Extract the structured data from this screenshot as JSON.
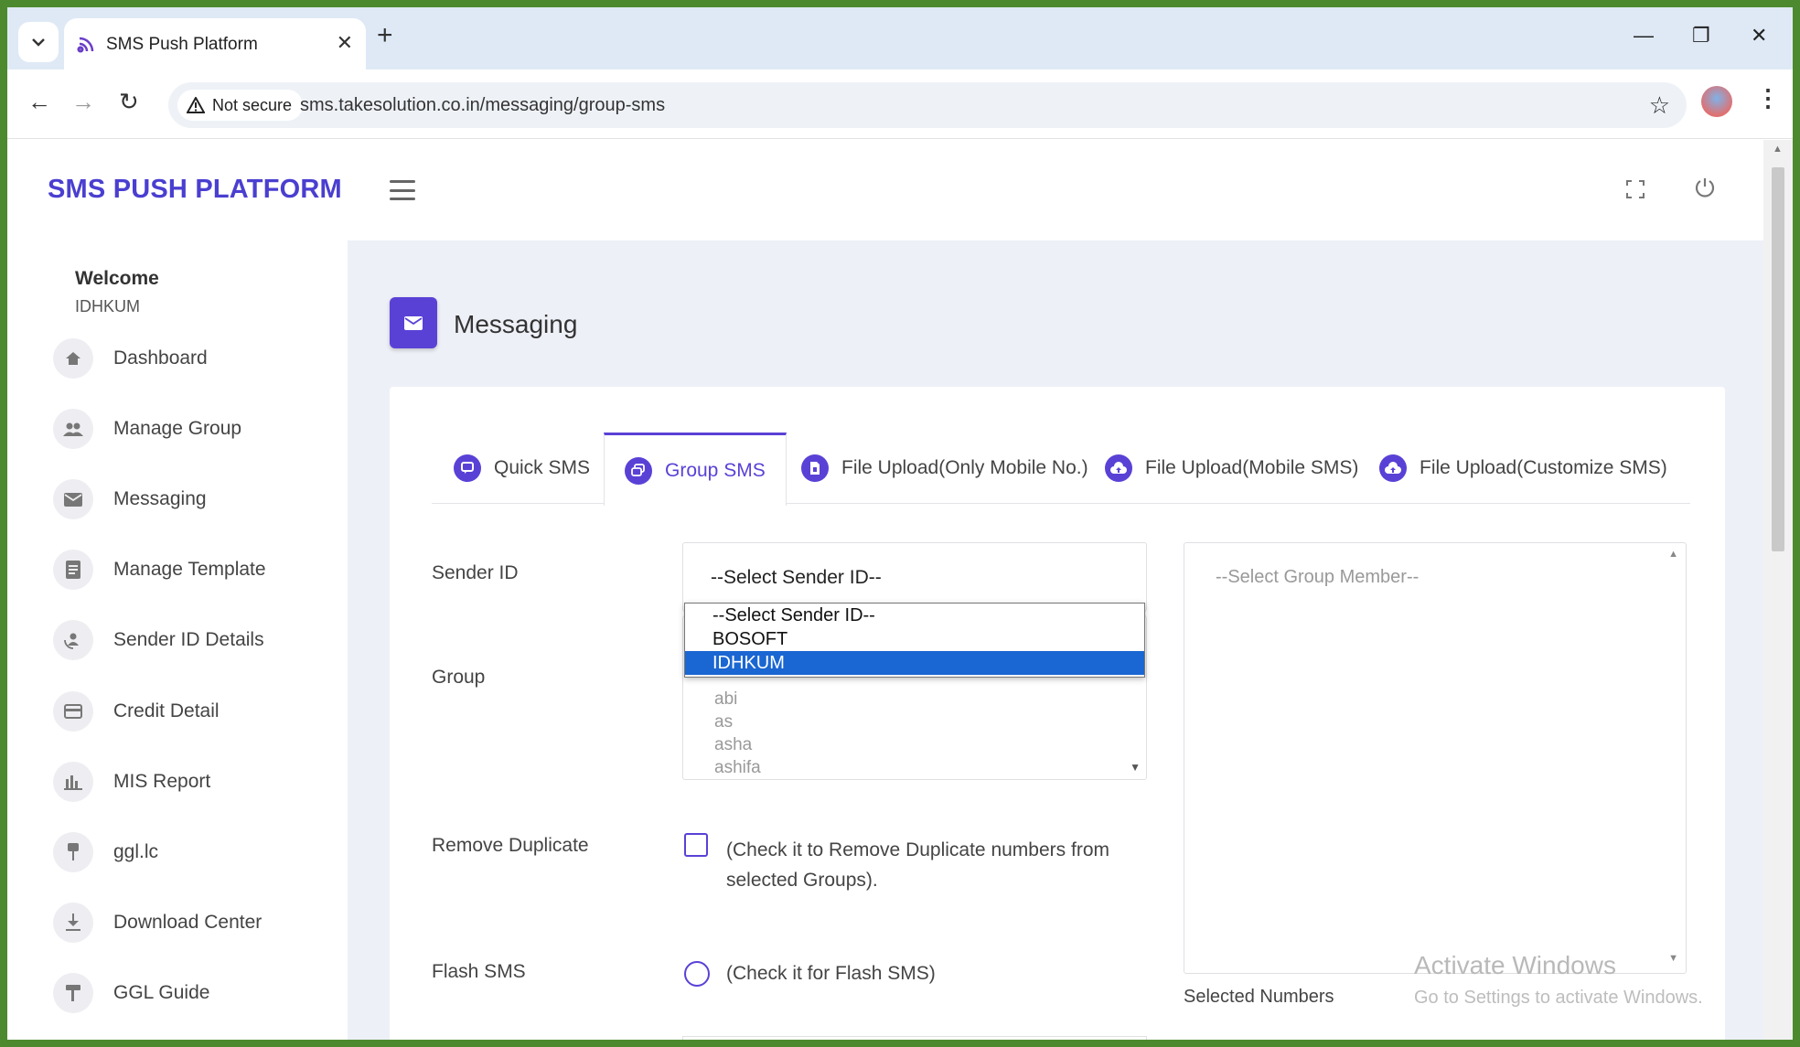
{
  "browser": {
    "tab_title": "SMS Push Platform",
    "not_secure_label": "Not secure",
    "url": "sms.takesolution.co.in/messaging/group-sms"
  },
  "app": {
    "brand": "SMS PUSH PLATFORM",
    "welcome_label": "Welcome",
    "username": "IDHKUM",
    "sidebar": {
      "items": [
        {
          "label": "Dashboard",
          "icon": "home-icon"
        },
        {
          "label": "Manage Group",
          "icon": "group-icon"
        },
        {
          "label": "Messaging",
          "icon": "mail-icon"
        },
        {
          "label": "Manage Template",
          "icon": "document-icon"
        },
        {
          "label": "Sender ID Details",
          "icon": "sender-icon"
        },
        {
          "label": "Credit Detail",
          "icon": "card-icon"
        },
        {
          "label": "MIS Report",
          "icon": "bar-chart-icon"
        },
        {
          "label": "ggl.lc",
          "icon": "pin-icon"
        },
        {
          "label": "Download Center",
          "icon": "download-icon"
        },
        {
          "label": "GGL Guide",
          "icon": "guide-icon"
        }
      ]
    },
    "page_title": "Messaging",
    "tabs": [
      {
        "label": "Quick SMS",
        "active": false
      },
      {
        "label": "Group SMS",
        "active": true
      },
      {
        "label": "File Upload(Only Mobile No.)",
        "active": false
      },
      {
        "label": "File Upload(Mobile SMS)",
        "active": false
      },
      {
        "label": "File Upload(Customize SMS)",
        "active": false
      }
    ],
    "form": {
      "sender_id_label": "Sender ID",
      "sender_id_value": "--Select Sender ID--",
      "sender_id_options": [
        "--Select Sender ID--",
        "BOSOFT",
        "IDHKUM"
      ],
      "sender_id_highlighted": "IDHKUM",
      "group_label": "Group",
      "group_items": [
        "abi",
        "as",
        "asha",
        "ashifa"
      ],
      "group_member_placeholder": "--Select Group Member--",
      "remove_duplicate_label": "Remove Duplicate",
      "remove_duplicate_text": "(Check it to Remove Duplicate numbers from selected Groups).",
      "flash_sms_label": "Flash SMS",
      "flash_sms_text": "(Check it for Flash SMS)",
      "selected_numbers_label": "Selected Numbers"
    }
  },
  "watermark": {
    "line1": "Activate Windows",
    "line2": "Go to Settings to activate Windows."
  },
  "colors": {
    "accent": "#5a41d6",
    "brand": "#4a3fd0",
    "highlight": "#1a66d2",
    "frame_border": "#4d8a2f"
  }
}
